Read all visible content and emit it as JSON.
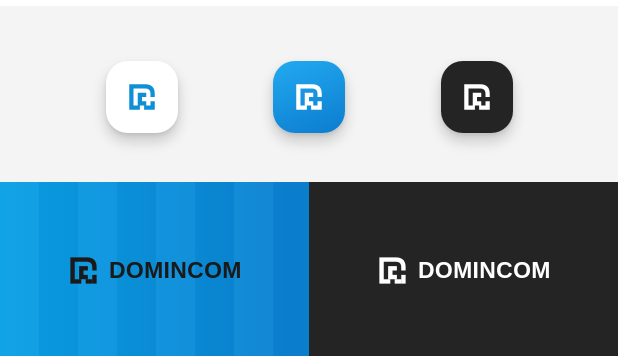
{
  "brand": {
    "wordmark": "DOMINCOM",
    "mark_icon": "dc-monogram-icon"
  },
  "icons": [
    {
      "variant": "white",
      "background": "#ffffff",
      "mark_color": "#0e8fd6"
    },
    {
      "variant": "blue",
      "background_gradient": [
        "#22aaf0",
        "#0c7ccf"
      ],
      "mark_color": "#ffffff"
    },
    {
      "variant": "black",
      "background": "#242424",
      "mark_color": "#ffffff"
    }
  ],
  "banners": {
    "blue": {
      "background_gradient": [
        "#0aa0e6",
        "#0b80d0"
      ],
      "text_color": "#1a1a1a"
    },
    "dark": {
      "background": "#242424",
      "text_color": "#ffffff"
    }
  },
  "colors": {
    "brand_blue": "#0e8fd6",
    "panel_gray": "#f4f4f4",
    "dark": "#242424"
  }
}
